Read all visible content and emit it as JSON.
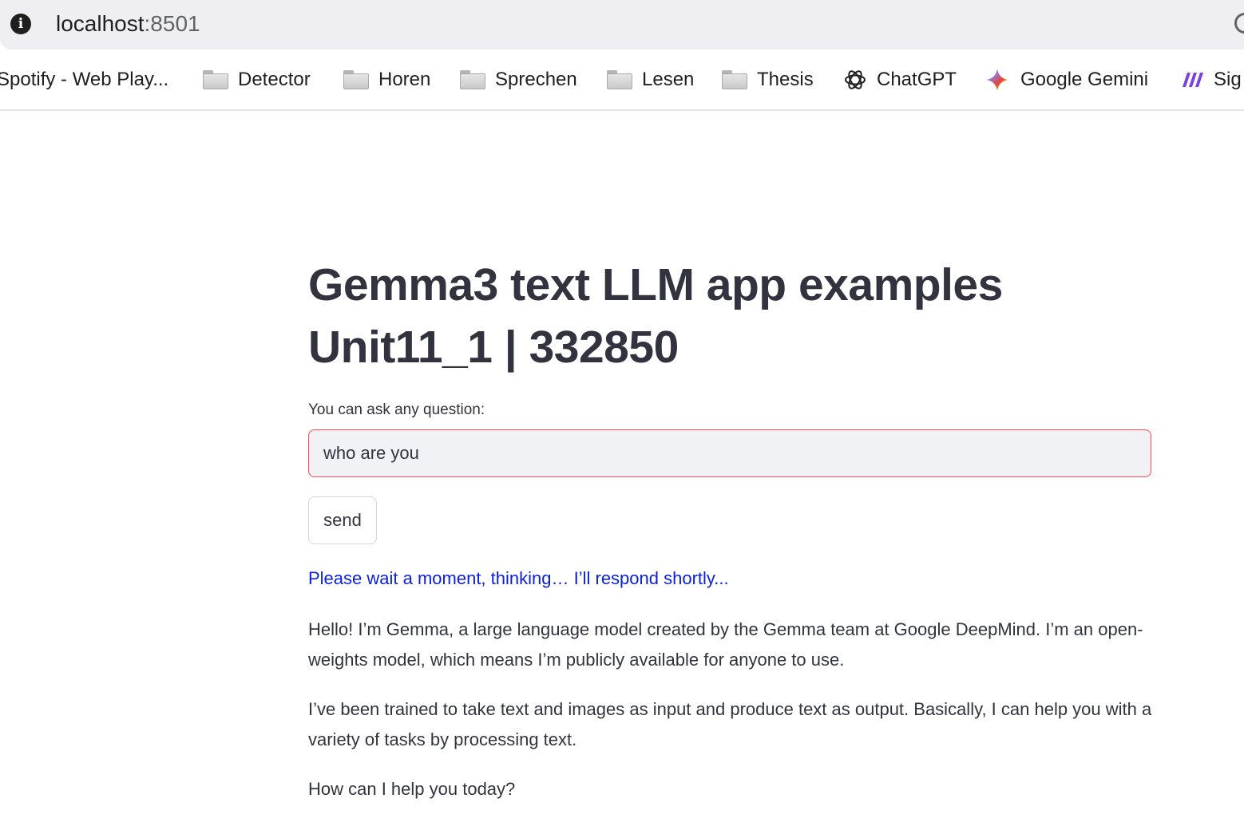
{
  "browser": {
    "url_host": "localhost",
    "url_port": ":8501",
    "bookmarks": [
      {
        "label": "Spotify - Web Play...",
        "icon": "none"
      },
      {
        "label": "Detector",
        "icon": "folder-icon"
      },
      {
        "label": "Horen",
        "icon": "folder-icon"
      },
      {
        "label": "Sprechen",
        "icon": "folder-icon"
      },
      {
        "label": "Lesen",
        "icon": "folder-icon"
      },
      {
        "label": "Thesis",
        "icon": "folder-icon"
      },
      {
        "label": "ChatGPT",
        "icon": "chatgpt-icon"
      },
      {
        "label": "Google Gemini",
        "icon": "gemini-icon"
      },
      {
        "label": "Sig",
        "icon": "sig-icon"
      }
    ]
  },
  "app": {
    "title_line1": "Gemma3 text LLM app examples",
    "title_line2": "Unit11_1 | 332850",
    "input_label": "You can ask any question:",
    "input_value": "who are you",
    "send_label": "send",
    "status": "Please wait a moment, thinking… I’ll respond shortly...",
    "response": [
      "Hello! I’m Gemma, a large language model created by the Gemma team at Google DeepMind. I’m an open-weights model, which means I’m publicly available for anyone to use.",
      "I’ve been trained to take text and images as input and produce text as output. Basically, I can help you with a variety of tasks by processing text.",
      "How can I help you today?"
    ]
  },
  "colors": {
    "accent_input_border": "#ff4b4b",
    "status_text": "#0a1fdb",
    "text": "#31333f",
    "input_bg": "#f0f2f6"
  }
}
